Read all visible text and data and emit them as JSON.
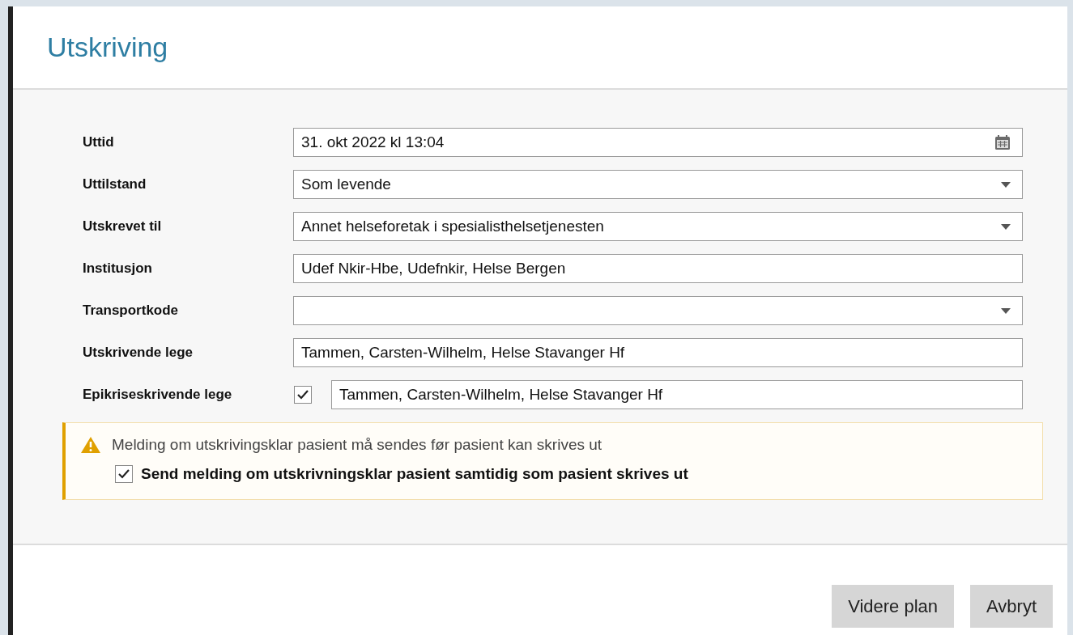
{
  "dialog": {
    "title": "Utskriving"
  },
  "fields": [
    {
      "label": "Uttid",
      "kind": "date",
      "value": "31. okt 2022 kl 13:04"
    },
    {
      "label": "Uttilstand",
      "kind": "select",
      "value": "Som levende"
    },
    {
      "label": "Utskrevet til",
      "kind": "select",
      "value": "Annet helseforetak i spesialisthelsetjenesten"
    },
    {
      "label": "Institusjon",
      "kind": "text",
      "value": "Udef Nkir-Hbe, Udefnkir, Helse Bergen"
    },
    {
      "label": "Transportkode",
      "kind": "select"
    },
    {
      "label": "Utskrivende lege",
      "kind": "text",
      "value": "Tammen, Carsten-Wilhelm, Helse Stavanger Hf"
    },
    {
      "label": "Epikriseskrivende lege",
      "kind": "checked_text",
      "checked": true,
      "value": "Tammen, Carsten-Wilhelm, Helse Stavanger Hf"
    }
  ],
  "warning": {
    "message": "Melding om utskrivingsklar pasient må sendes før pasient kan skrives ut",
    "option": {
      "label": "Send melding om utskrivningsklar pasient samtidig som pasient skrives ut",
      "checked": true
    }
  },
  "buttons": [
    "Videre plan",
    "Avbryt"
  ]
}
